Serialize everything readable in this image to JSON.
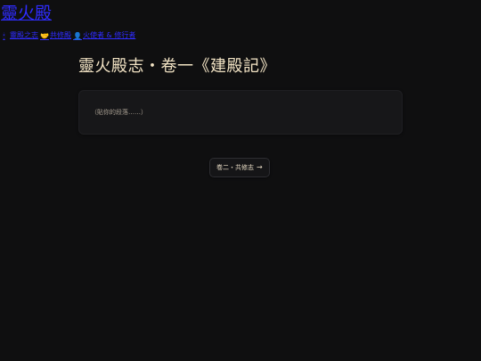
{
  "site": {
    "title": "靈火殿",
    "nav": [
      {
        "icon": "🕯",
        "icon_name": "candle-icon",
        "label": "靈殿之志"
      },
      {
        "icon": "🤝",
        "icon_name": "handshake-icon",
        "label": "共修殿"
      },
      {
        "icon": "👤",
        "icon_name": "person-icon",
        "label": "火使者 & 修行者"
      }
    ]
  },
  "main": {
    "title": "靈火殿志・卷一《建殿記》",
    "paste_placeholder": "（貼你的段落……）",
    "next_button_label": "卷二・共修志",
    "next_button_arrow": "→"
  },
  "colors": {
    "background": "#0f0f10",
    "link": "#2f2cff",
    "title": "#f2e3c4",
    "card": "#171719"
  }
}
